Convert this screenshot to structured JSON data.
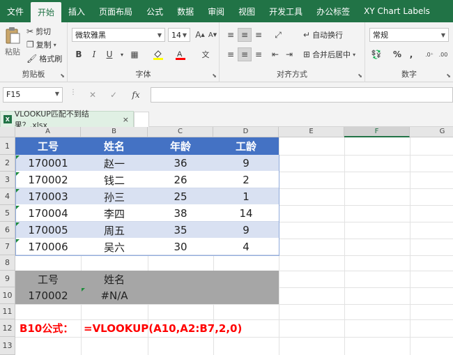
{
  "ribbon_tabs": [
    "文件",
    "开始",
    "插入",
    "页面布局",
    "公式",
    "数据",
    "审阅",
    "视图",
    "开发工具",
    "办公标签",
    "XY Chart Labels"
  ],
  "clipboard": {
    "paste": "粘贴",
    "cut": "剪切",
    "copy": "复制",
    "painter": "格式刷",
    "label": "剪贴板"
  },
  "font": {
    "name": "微软雅黑",
    "size": "14",
    "grow": "A",
    "shrink": "A",
    "bold": "B",
    "italic": "I",
    "underline": "U",
    "label": "字体"
  },
  "alignment": {
    "wrap": "自动换行",
    "merge": "合并后居中",
    "label": "对齐方式"
  },
  "number": {
    "format": "常规",
    "percent": "%",
    "comma": ",",
    "label": "数字"
  },
  "formula_bar": {
    "name_box": "F15",
    "cancel": "✕",
    "enter": "✓",
    "fx": "fx",
    "value": ""
  },
  "document": {
    "tab_title": "VLOOKUP匹配不到结果？.xlsx",
    "close": "×"
  },
  "grid": {
    "columns": [
      "A",
      "B",
      "C",
      "D",
      "E",
      "F",
      "G"
    ],
    "rows": [
      "1",
      "2",
      "3",
      "4",
      "5",
      "6",
      "7",
      "8",
      "9",
      "10",
      "11",
      "12",
      "13"
    ],
    "selected_column": "F"
  },
  "table": {
    "headers": [
      "工号",
      "姓名",
      "年龄",
      "工龄"
    ],
    "rows": [
      [
        "170001",
        "赵一",
        "36",
        "9"
      ],
      [
        "170002",
        "钱二",
        "26",
        "2"
      ],
      [
        "170003",
        "孙三",
        "25",
        "1"
      ],
      [
        "170004",
        "李四",
        "38",
        "14"
      ],
      [
        "170005",
        "周五",
        "35",
        "9"
      ],
      [
        "170006",
        "吴六",
        "30",
        "4"
      ]
    ]
  },
  "lookup": {
    "header_id": "工号",
    "header_name": "姓名",
    "value_id": "170002",
    "value_result": "#N/A"
  },
  "formula_note": {
    "label": "B10公式：",
    "formula": "=VLOOKUP(A10,A2:B7,2,0)"
  },
  "colors": {
    "excel_green": "#217346",
    "table_header": "#4472c4",
    "band_light": "#d9e1f2",
    "lookup_fill": "#a6a6a6",
    "formula_red": "#ff0000"
  }
}
